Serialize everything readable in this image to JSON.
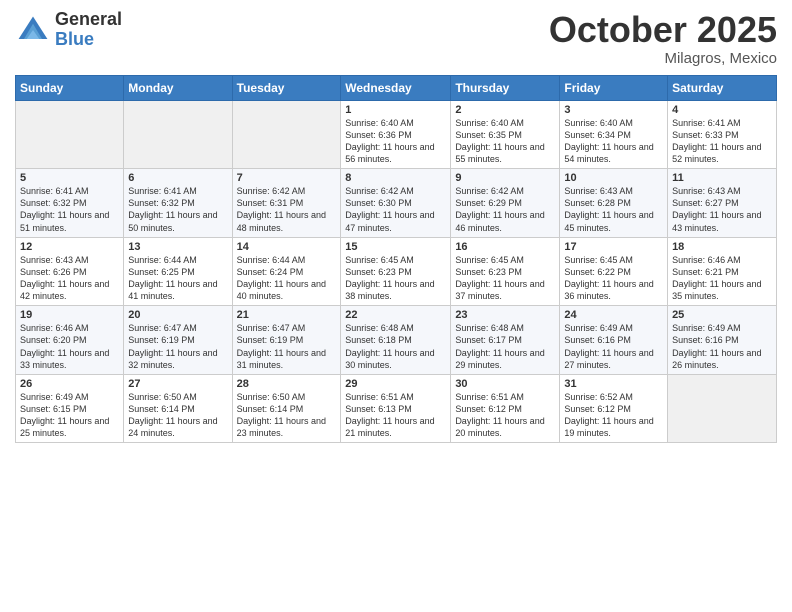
{
  "logo": {
    "general": "General",
    "blue": "Blue"
  },
  "header": {
    "month": "October 2025",
    "location": "Milagros, Mexico"
  },
  "weekdays": [
    "Sunday",
    "Monday",
    "Tuesday",
    "Wednesday",
    "Thursday",
    "Friday",
    "Saturday"
  ],
  "weeks": [
    [
      {
        "day": "",
        "info": ""
      },
      {
        "day": "",
        "info": ""
      },
      {
        "day": "",
        "info": ""
      },
      {
        "day": "1",
        "info": "Sunrise: 6:40 AM\nSunset: 6:36 PM\nDaylight: 11 hours and 56 minutes."
      },
      {
        "day": "2",
        "info": "Sunrise: 6:40 AM\nSunset: 6:35 PM\nDaylight: 11 hours and 55 minutes."
      },
      {
        "day": "3",
        "info": "Sunrise: 6:40 AM\nSunset: 6:34 PM\nDaylight: 11 hours and 54 minutes."
      },
      {
        "day": "4",
        "info": "Sunrise: 6:41 AM\nSunset: 6:33 PM\nDaylight: 11 hours and 52 minutes."
      }
    ],
    [
      {
        "day": "5",
        "info": "Sunrise: 6:41 AM\nSunset: 6:32 PM\nDaylight: 11 hours and 51 minutes."
      },
      {
        "day": "6",
        "info": "Sunrise: 6:41 AM\nSunset: 6:32 PM\nDaylight: 11 hours and 50 minutes."
      },
      {
        "day": "7",
        "info": "Sunrise: 6:42 AM\nSunset: 6:31 PM\nDaylight: 11 hours and 48 minutes."
      },
      {
        "day": "8",
        "info": "Sunrise: 6:42 AM\nSunset: 6:30 PM\nDaylight: 11 hours and 47 minutes."
      },
      {
        "day": "9",
        "info": "Sunrise: 6:42 AM\nSunset: 6:29 PM\nDaylight: 11 hours and 46 minutes."
      },
      {
        "day": "10",
        "info": "Sunrise: 6:43 AM\nSunset: 6:28 PM\nDaylight: 11 hours and 45 minutes."
      },
      {
        "day": "11",
        "info": "Sunrise: 6:43 AM\nSunset: 6:27 PM\nDaylight: 11 hours and 43 minutes."
      }
    ],
    [
      {
        "day": "12",
        "info": "Sunrise: 6:43 AM\nSunset: 6:26 PM\nDaylight: 11 hours and 42 minutes."
      },
      {
        "day": "13",
        "info": "Sunrise: 6:44 AM\nSunset: 6:25 PM\nDaylight: 11 hours and 41 minutes."
      },
      {
        "day": "14",
        "info": "Sunrise: 6:44 AM\nSunset: 6:24 PM\nDaylight: 11 hours and 40 minutes."
      },
      {
        "day": "15",
        "info": "Sunrise: 6:45 AM\nSunset: 6:23 PM\nDaylight: 11 hours and 38 minutes."
      },
      {
        "day": "16",
        "info": "Sunrise: 6:45 AM\nSunset: 6:23 PM\nDaylight: 11 hours and 37 minutes."
      },
      {
        "day": "17",
        "info": "Sunrise: 6:45 AM\nSunset: 6:22 PM\nDaylight: 11 hours and 36 minutes."
      },
      {
        "day": "18",
        "info": "Sunrise: 6:46 AM\nSunset: 6:21 PM\nDaylight: 11 hours and 35 minutes."
      }
    ],
    [
      {
        "day": "19",
        "info": "Sunrise: 6:46 AM\nSunset: 6:20 PM\nDaylight: 11 hours and 33 minutes."
      },
      {
        "day": "20",
        "info": "Sunrise: 6:47 AM\nSunset: 6:19 PM\nDaylight: 11 hours and 32 minutes."
      },
      {
        "day": "21",
        "info": "Sunrise: 6:47 AM\nSunset: 6:19 PM\nDaylight: 11 hours and 31 minutes."
      },
      {
        "day": "22",
        "info": "Sunrise: 6:48 AM\nSunset: 6:18 PM\nDaylight: 11 hours and 30 minutes."
      },
      {
        "day": "23",
        "info": "Sunrise: 6:48 AM\nSunset: 6:17 PM\nDaylight: 11 hours and 29 minutes."
      },
      {
        "day": "24",
        "info": "Sunrise: 6:49 AM\nSunset: 6:16 PM\nDaylight: 11 hours and 27 minutes."
      },
      {
        "day": "25",
        "info": "Sunrise: 6:49 AM\nSunset: 6:16 PM\nDaylight: 11 hours and 26 minutes."
      }
    ],
    [
      {
        "day": "26",
        "info": "Sunrise: 6:49 AM\nSunset: 6:15 PM\nDaylight: 11 hours and 25 minutes."
      },
      {
        "day": "27",
        "info": "Sunrise: 6:50 AM\nSunset: 6:14 PM\nDaylight: 11 hours and 24 minutes."
      },
      {
        "day": "28",
        "info": "Sunrise: 6:50 AM\nSunset: 6:14 PM\nDaylight: 11 hours and 23 minutes."
      },
      {
        "day": "29",
        "info": "Sunrise: 6:51 AM\nSunset: 6:13 PM\nDaylight: 11 hours and 21 minutes."
      },
      {
        "day": "30",
        "info": "Sunrise: 6:51 AM\nSunset: 6:12 PM\nDaylight: 11 hours and 20 minutes."
      },
      {
        "day": "31",
        "info": "Sunrise: 6:52 AM\nSunset: 6:12 PM\nDaylight: 11 hours and 19 minutes."
      },
      {
        "day": "",
        "info": ""
      }
    ]
  ]
}
